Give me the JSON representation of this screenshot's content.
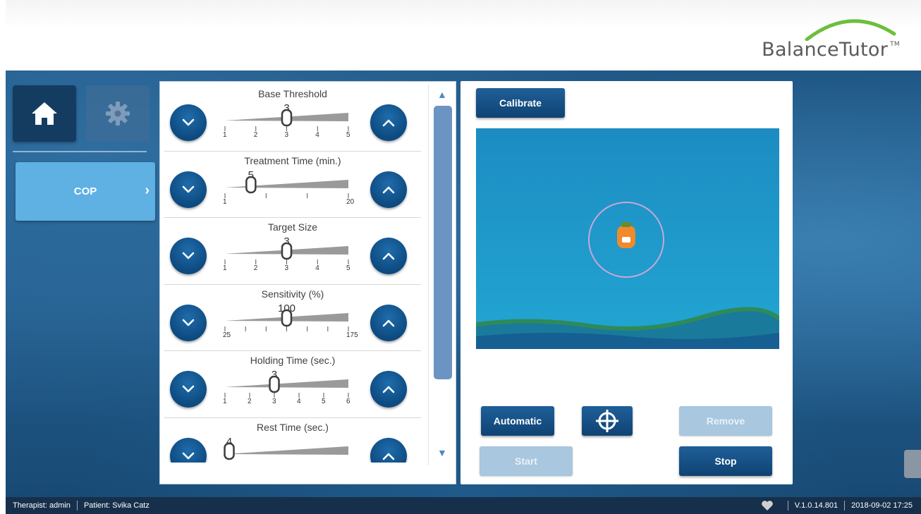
{
  "brand": {
    "name": "BalanceTutor",
    "tm": "TM"
  },
  "nav": {
    "home_icon": "home-icon",
    "settings_icon": "gear-icon",
    "mode_label": "COP",
    "mode_chevron": "›"
  },
  "params": [
    {
      "title": "Base Threshold",
      "value": "3",
      "min": 1,
      "max": 5,
      "current": 3,
      "tick_labels": [
        "1",
        "2",
        "3",
        "4",
        "5"
      ],
      "minor_ticks": 5
    },
    {
      "title": "Treatment Time (min.)",
      "value": "5",
      "min": 1,
      "max": 20,
      "current": 5,
      "tick_labels": [
        "1",
        "",
        "",
        "20"
      ],
      "minor_ticks": 4
    },
    {
      "title": "Target Size",
      "value": "3",
      "min": 1,
      "max": 5,
      "current": 3,
      "tick_labels": [
        "1",
        "2",
        "3",
        "4",
        "5"
      ],
      "minor_ticks": 5
    },
    {
      "title": "Sensitivity (%)",
      "value": "100",
      "min": 25,
      "max": 175,
      "current": 100,
      "tick_labels": [
        "25",
        "",
        "",
        "",
        "",
        "",
        "175"
      ],
      "minor_ticks": 7
    },
    {
      "title": "Holding Time (sec.)",
      "value": "3",
      "min": 1,
      "max": 6,
      "current": 3,
      "tick_labels": [
        "1",
        "2",
        "3",
        "4",
        "5",
        "6"
      ],
      "minor_ticks": 6
    },
    {
      "title": "Rest Time (sec.)",
      "value": "4",
      "min": 1,
      "max": 30,
      "current": 2,
      "tick_labels": [],
      "minor_ticks": 0
    }
  ],
  "buttons": {
    "calibrate": "Calibrate",
    "automatic": "Automatic",
    "remove": "Remove",
    "start": "Start",
    "stop": "Stop",
    "target_icon": "crosshair-icon"
  },
  "status": {
    "therapist": "Therapist: admin",
    "patient": "Patient: Svika Catz",
    "heart_icon": "heart-icon",
    "version": "V.1.0.14.801",
    "datetime": "2018-09-02 17:25"
  },
  "colors": {
    "primary": "#0f4373",
    "accent": "#5fb0e3",
    "water": "#1b93c6",
    "sea_floor": "#1a5f96"
  }
}
